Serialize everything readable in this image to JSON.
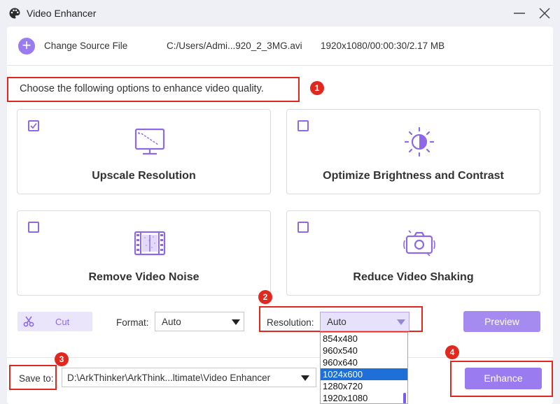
{
  "window": {
    "title": "Video Enhancer",
    "minimize_icon": "minimize-icon",
    "close_icon": "close-icon"
  },
  "source": {
    "change_label": "Change Source File",
    "file_path": "C:/Users/Admi...920_2_3MG.avi",
    "file_meta": "1920x1080/00:00:30/2.17 MB"
  },
  "instruction": "Choose the following options to enhance video quality.",
  "options": [
    {
      "label": "Upscale Resolution",
      "checked": true,
      "icon": "monitor-icon"
    },
    {
      "label": "Optimize Brightness and Contrast",
      "checked": false,
      "icon": "brightness-icon"
    },
    {
      "label": "Remove Video Noise",
      "checked": false,
      "icon": "film-icon"
    },
    {
      "label": "Reduce Video Shaking",
      "checked": false,
      "icon": "camera-shake-icon"
    }
  ],
  "controls": {
    "cut_label": "Cut",
    "format_label": "Format:",
    "format_value": "Auto",
    "resolution_label": "Resolution:",
    "resolution_value": "Auto",
    "preview_label": "Preview",
    "save_label": "Save to:",
    "save_path": "D:\\ArkThinker\\ArkThink...ltimate\\Video Enhancer",
    "more_label": "...",
    "enhance_label": "Enhance"
  },
  "resolution_options": [
    "854x480",
    "960x540",
    "960x640",
    "1024x600",
    "1280x720",
    "1920x1080"
  ],
  "resolution_selected": "1024x600",
  "badges": [
    "1",
    "2",
    "3",
    "4"
  ],
  "colors": {
    "accent": "#9a7bf0",
    "annotation_red": "#e0281e",
    "selection_blue": "#1e6fd8"
  }
}
